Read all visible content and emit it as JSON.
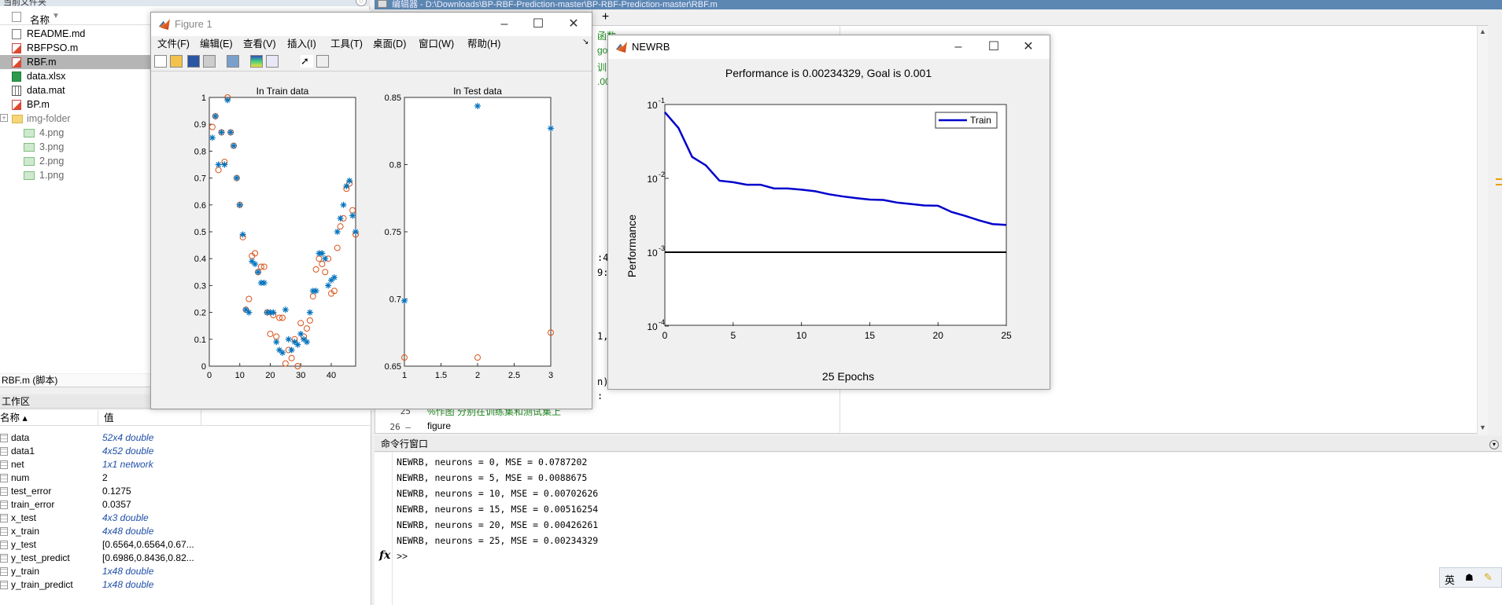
{
  "file_panel": {
    "title": "当前文件夹",
    "column_name": "名称",
    "files": [
      {
        "name": "README.md",
        "kind": "doc"
      },
      {
        "name": "RBFPSO.m",
        "kind": "m"
      },
      {
        "name": "RBF.m",
        "kind": "m"
      },
      {
        "name": "data.xlsx",
        "kind": "xlsx"
      },
      {
        "name": "data.mat",
        "kind": "mat"
      },
      {
        "name": "BP.m",
        "kind": "m"
      },
      {
        "name": "img-folder",
        "kind": "folder"
      },
      {
        "name": "4.png",
        "kind": "png"
      },
      {
        "name": "3.png",
        "kind": "png"
      },
      {
        "name": "2.png",
        "kind": "png"
      },
      {
        "name": "1.png",
        "kind": "png"
      }
    ]
  },
  "details_bar": "RBF.m (脚本)",
  "workspace": {
    "title": "工作区",
    "col_name": "名称 ▴",
    "col_value": "值",
    "vars": [
      {
        "name": "data",
        "value": "52x4 double",
        "italic": true
      },
      {
        "name": "data1",
        "value": "4x52 double",
        "italic": true
      },
      {
        "name": "net",
        "value": "1x1 network",
        "italic": true
      },
      {
        "name": "num",
        "value": "2",
        "italic": false
      },
      {
        "name": "test_error",
        "value": "0.1275",
        "italic": false
      },
      {
        "name": "train_error",
        "value": "0.0357",
        "italic": false
      },
      {
        "name": "x_test",
        "value": "4x3 double",
        "italic": true
      },
      {
        "name": "x_train",
        "value": "4x48 double",
        "italic": true
      },
      {
        "name": "y_test",
        "value": "[0.6564,0.6564,0.67...",
        "italic": false
      },
      {
        "name": "y_test_predict",
        "value": "[0.6986,0.8436,0.82...",
        "italic": false
      },
      {
        "name": "y_train",
        "value": "1x48 double",
        "italic": true
      },
      {
        "name": "y_train_predict",
        "value": "1x48 double",
        "italic": true
      }
    ]
  },
  "editor": {
    "tab_title": "编辑器 - D:\\Downloads\\BP-RBF-Prediction-master\\BP-RBF-Prediction-master\\RBF.m",
    "new_tab": "+",
    "fragments": [
      {
        "text": "函数",
        "cls": "c",
        "row": 0
      },
      {
        "text": "go",
        "cls": "c",
        "row": 1
      },
      {
        "text": "训",
        "cls": "c",
        "row": 2
      },
      {
        "text": ".00",
        "cls": "c",
        "row": 3
      },
      {
        "text": ":48",
        "cls": "",
        "row": 4
      },
      {
        "text": "9:5",
        "cls": "",
        "row": 5
      },
      {
        "text": "1,1",
        "cls": "",
        "row": 6
      },
      {
        "text": "n):",
        "cls": "",
        "row": 7
      },
      {
        "text": ":",
        "cls": "",
        "row": 8
      }
    ],
    "line25_num": "25",
    "line25_text": "%作图 分别在训练集和测试集上",
    "line26_num": "26 –",
    "line26_text": "figure"
  },
  "command_window": {
    "title": "命令行窗口",
    "lines": [
      "NEWRB, neurons = 0, MSE = 0.0787202",
      "NEWRB, neurons = 5, MSE = 0.0088675",
      "NEWRB, neurons = 10, MSE = 0.00702626",
      "NEWRB, neurons = 15, MSE = 0.00516254",
      "NEWRB, neurons = 20, MSE = 0.00426261",
      "NEWRB, neurons = 25, MSE = 0.00234329"
    ],
    "fx": "fx",
    "prompt": ">>"
  },
  "figure1": {
    "title": "Figure 1",
    "menu": [
      "文件(F)",
      "编辑(E)",
      "查看(V)",
      "插入(I)",
      "工具(T)",
      "桌面(D)",
      "窗口(W)",
      "帮助(H)"
    ],
    "menu_arrow": "↘"
  },
  "newrb_window": {
    "title": "NEWRB"
  },
  "ime": {
    "lang": "英"
  },
  "chart_data": [
    {
      "type": "scatter",
      "title": "In Train data",
      "xlim": [
        0,
        48
      ],
      "ylim": [
        0,
        1
      ],
      "xticks": [
        "0",
        "10",
        "20",
        "30",
        "40"
      ],
      "yticks": [
        "0",
        "0.1",
        "0.2",
        "0.3",
        "0.4",
        "0.5",
        "0.6",
        "0.7",
        "0.8",
        "0.9",
        "1"
      ],
      "series": [
        {
          "marker": "circle",
          "color": "#d95319",
          "x": [
            1,
            2,
            3,
            4,
            5,
            6,
            7,
            8,
            9,
            10,
            11,
            12,
            13,
            14,
            15,
            16,
            17,
            18,
            19,
            20,
            21,
            22,
            23,
            24,
            25,
            26,
            27,
            28,
            29,
            30,
            31,
            32,
            33,
            34,
            35,
            36,
            37,
            38,
            39,
            40,
            41,
            42,
            43,
            44,
            45,
            46,
            47,
            48
          ],
          "y": [
            0.89,
            0.93,
            0.73,
            0.87,
            0.76,
            1.0,
            0.87,
            0.82,
            0.7,
            0.6,
            0.48,
            0.21,
            0.25,
            0.41,
            0.42,
            0.35,
            0.37,
            0.37,
            0.2,
            0.12,
            0.19,
            0.11,
            0.18,
            0.18,
            0.01,
            0.06,
            0.03,
            0.1,
            0.0,
            0.16,
            0.11,
            0.14,
            0.17,
            0.26,
            0.36,
            0.4,
            0.38,
            0.35,
            0.4,
            0.27,
            0.28,
            0.44,
            0.52,
            0.55,
            0.66,
            0.68,
            0.58,
            0.49
          ]
        },
        {
          "marker": "asterisk",
          "color": "#0072bd",
          "x": [
            1,
            2,
            3,
            4,
            5,
            6,
            7,
            8,
            9,
            10,
            11,
            12,
            13,
            14,
            15,
            16,
            17,
            18,
            19,
            20,
            21,
            22,
            23,
            24,
            25,
            26,
            27,
            28,
            29,
            30,
            31,
            32,
            33,
            34,
            35,
            36,
            37,
            38,
            39,
            40,
            41,
            42,
            43,
            44,
            45,
            46,
            47,
            48
          ],
          "y": [
            0.85,
            0.93,
            0.75,
            0.87,
            0.75,
            0.99,
            0.87,
            0.82,
            0.7,
            0.6,
            0.49,
            0.21,
            0.2,
            0.39,
            0.38,
            0.35,
            0.31,
            0.31,
            0.2,
            0.2,
            0.2,
            0.09,
            0.06,
            0.05,
            0.21,
            0.1,
            0.06,
            0.09,
            0.08,
            0.12,
            0.1,
            0.09,
            0.2,
            0.28,
            0.28,
            0.42,
            0.42,
            0.4,
            0.3,
            0.32,
            0.33,
            0.5,
            0.55,
            0.6,
            0.67,
            0.69,
            0.56,
            0.5
          ]
        }
      ]
    },
    {
      "type": "scatter",
      "title": "In Test data",
      "xlim": [
        1,
        3
      ],
      "ylim": [
        0.65,
        0.85
      ],
      "xticks": [
        "1",
        "1.5",
        "2",
        "2.5",
        "3"
      ],
      "yticks": [
        "0.65",
        "0.7",
        "0.75",
        "0.8",
        "0.85"
      ],
      "series": [
        {
          "marker": "circle",
          "color": "#d95319",
          "x": [
            1,
            2,
            3
          ],
          "y": [
            0.6564,
            0.6564,
            0.675
          ]
        },
        {
          "marker": "asterisk",
          "color": "#0072bd",
          "x": [
            1,
            2,
            3
          ],
          "y": [
            0.6986,
            0.8436,
            0.827
          ]
        }
      ]
    },
    {
      "type": "line",
      "title": "Performance is 0.00234329, Goal is 0.001",
      "xlabel": "25 Epochs",
      "ylabel": "Performance",
      "xlim": [
        0,
        25
      ],
      "ylim_log10": [
        -4,
        -1
      ],
      "xticks": [
        "0",
        "5",
        "10",
        "15",
        "20",
        "25"
      ],
      "yticks": [
        {
          "base": "10",
          "exp": "-1"
        },
        {
          "base": "10",
          "exp": "-2"
        },
        {
          "base": "10",
          "exp": "-3"
        },
        {
          "base": "10",
          "exp": "-4"
        }
      ],
      "legend": "top-right",
      "series": [
        {
          "name": "Train",
          "color": "#0000cc",
          "x": [
            0,
            1,
            2,
            3,
            4,
            5,
            6,
            7,
            8,
            9,
            10,
            11,
            12,
            13,
            14,
            15,
            16,
            17,
            18,
            19,
            20,
            21,
            22,
            23,
            24,
            25
          ],
          "y": [
            0.0787202,
            0.048,
            0.0195,
            0.015,
            0.0093,
            0.0088675,
            0.0082,
            0.0082,
            0.0073,
            0.0073,
            0.00702626,
            0.0067,
            0.0061,
            0.0057,
            0.0054,
            0.00516254,
            0.0051,
            0.0047,
            0.0045,
            0.0043,
            0.00426261,
            0.0035,
            0.0031,
            0.0027,
            0.0024,
            0.00234329
          ]
        },
        {
          "name": "Goal",
          "color": "#000000",
          "x": [
            0,
            25
          ],
          "y": [
            0.001,
            0.001
          ]
        }
      ]
    }
  ]
}
